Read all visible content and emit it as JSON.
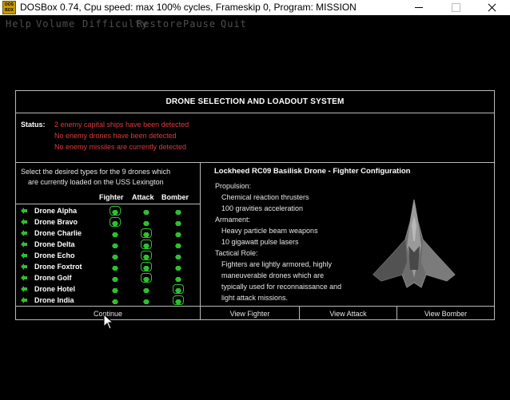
{
  "window": {
    "title": "DOSBox 0.74, Cpu speed: max 100% cycles, Frameskip  0, Program:  MISSION",
    "icon_text": "DOS BOX",
    "icon": "dosbox-icon"
  },
  "menu": [
    "Help",
    "Volume",
    "Difficulty",
    "Restore",
    "Pause",
    "Quit"
  ],
  "dialog": {
    "title": "DRONE SELECTION AND LOADOUT SYSTEM",
    "status_label": "Status:",
    "status_lines": [
      "2 enemy capital ships have been detected",
      "No enemy drones have been detected",
      "No enemy missiles are currently detected"
    ],
    "instructions": [
      "Select the desired types for the 9 drones which",
      "are currently loaded on the USS Lexington"
    ],
    "columns": [
      "Fighter",
      "Attack",
      "Bomber"
    ],
    "drones": [
      {
        "name": "Drone Alpha",
        "selected": "Fighter"
      },
      {
        "name": "Drone Bravo",
        "selected": "Fighter"
      },
      {
        "name": "Drone Charlie",
        "selected": "Attack"
      },
      {
        "name": "Drone Delta",
        "selected": "Attack"
      },
      {
        "name": "Drone Echo",
        "selected": "Attack"
      },
      {
        "name": "Drone Foxtrot",
        "selected": "Attack"
      },
      {
        "name": "Drone Golf",
        "selected": "Attack"
      },
      {
        "name": "Drone Hotel",
        "selected": "Bomber"
      },
      {
        "name": "Drone India",
        "selected": "Bomber"
      }
    ],
    "detail": {
      "heading": "Lockheed RC09 Basilisk Drone - Fighter Configuration",
      "lines": [
        "Propulsion:",
        "Chemical reaction thrusters",
        "100 gravities acceleration",
        "Armament:",
        "Heavy particle beam weapons",
        "10 gigawatt pulse lasers",
        "Tactical Role:",
        "Fighters are lightly armored, highly",
        "maneuverable drones which are",
        "typically used for reconnaissance and",
        "light attack missions."
      ]
    },
    "buttons": {
      "continue": "Continue",
      "view_fighter": "View Fighter",
      "view_attack": "View Attack",
      "view_bomber": "View Bomber"
    }
  },
  "colors": {
    "status_red": "#e03a3a",
    "green": "#2fbf2f",
    "border": "#b9b9b9",
    "menu_gray": "#4f4f4f"
  }
}
